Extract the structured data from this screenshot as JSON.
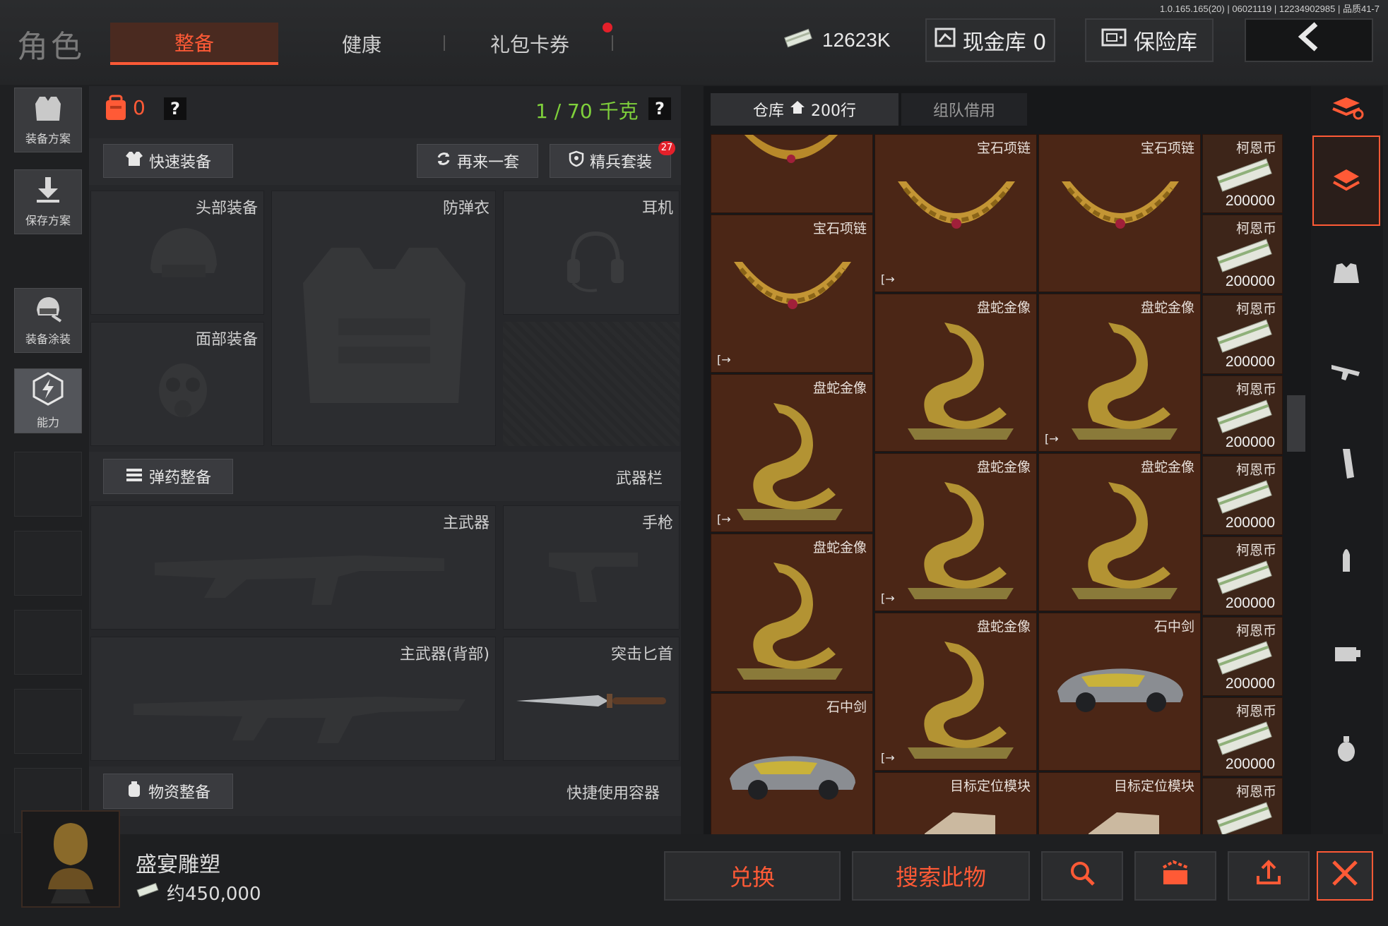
{
  "version": "1.0.165.165(20) | 06021119 | 12234902985 | 品质41-7",
  "header": {
    "title": "角色",
    "tabs": [
      {
        "label": "整备"
      },
      {
        "label": "健康"
      },
      {
        "label": "礼包卡券"
      }
    ],
    "cash": "12623K",
    "cash_vault": "现金库 0",
    "safe": "保险库",
    "back_icon": "chevron-left-icon"
  },
  "left_menu": [
    {
      "label": "装备方案",
      "icon": "vest-icon"
    },
    {
      "label": "保存方案",
      "icon": "download-icon"
    },
    {
      "label": "装备涂装",
      "icon": "helmet-paint-icon"
    },
    {
      "label": "能力",
      "icon": "ability-icon"
    }
  ],
  "equip": {
    "backpack_count": "0",
    "help": "?",
    "weight": "1 / 70 千克",
    "quick_equip": "快速装备",
    "again": "再来一套",
    "elite": "精兵套装",
    "elite_badge": "27",
    "slots": {
      "head": "头部装备",
      "armor": "防弹衣",
      "headset": "耳机",
      "face": "面部装备",
      "ammo_section": "弹药整备",
      "weapon_bar": "武器栏",
      "primary": "主武器",
      "pistol": "手枪",
      "primary_back": "主武器(背部)",
      "dagger": "突击匕首",
      "supply_section": "物资整备",
      "quick_container": "快捷使用容器"
    }
  },
  "warehouse": {
    "tab_main": "仓库",
    "tab_rows": "200行",
    "tab_team": "组队借用",
    "items": [
      {
        "name": "宝石项链",
        "kind": "necklace",
        "move": "[→"
      },
      {
        "name": "盘蛇金像",
        "kind": "snake",
        "move": "[→"
      },
      {
        "name": "石中剑",
        "kind": "car",
        "move": "[→"
      },
      {
        "name": "目标定位模块",
        "kind": "module",
        "move": "[→"
      }
    ],
    "coin_name": "柯恩币",
    "coin_amount": "200000"
  },
  "selected": {
    "name": "盛宴雕塑",
    "price": "约450,000"
  },
  "actions": {
    "exchange": "兑换",
    "search": "搜索此物"
  },
  "colors": {
    "accent": "#ff5a36",
    "weight_green": "#7fd13b",
    "cell_brown": "#4b2616"
  }
}
